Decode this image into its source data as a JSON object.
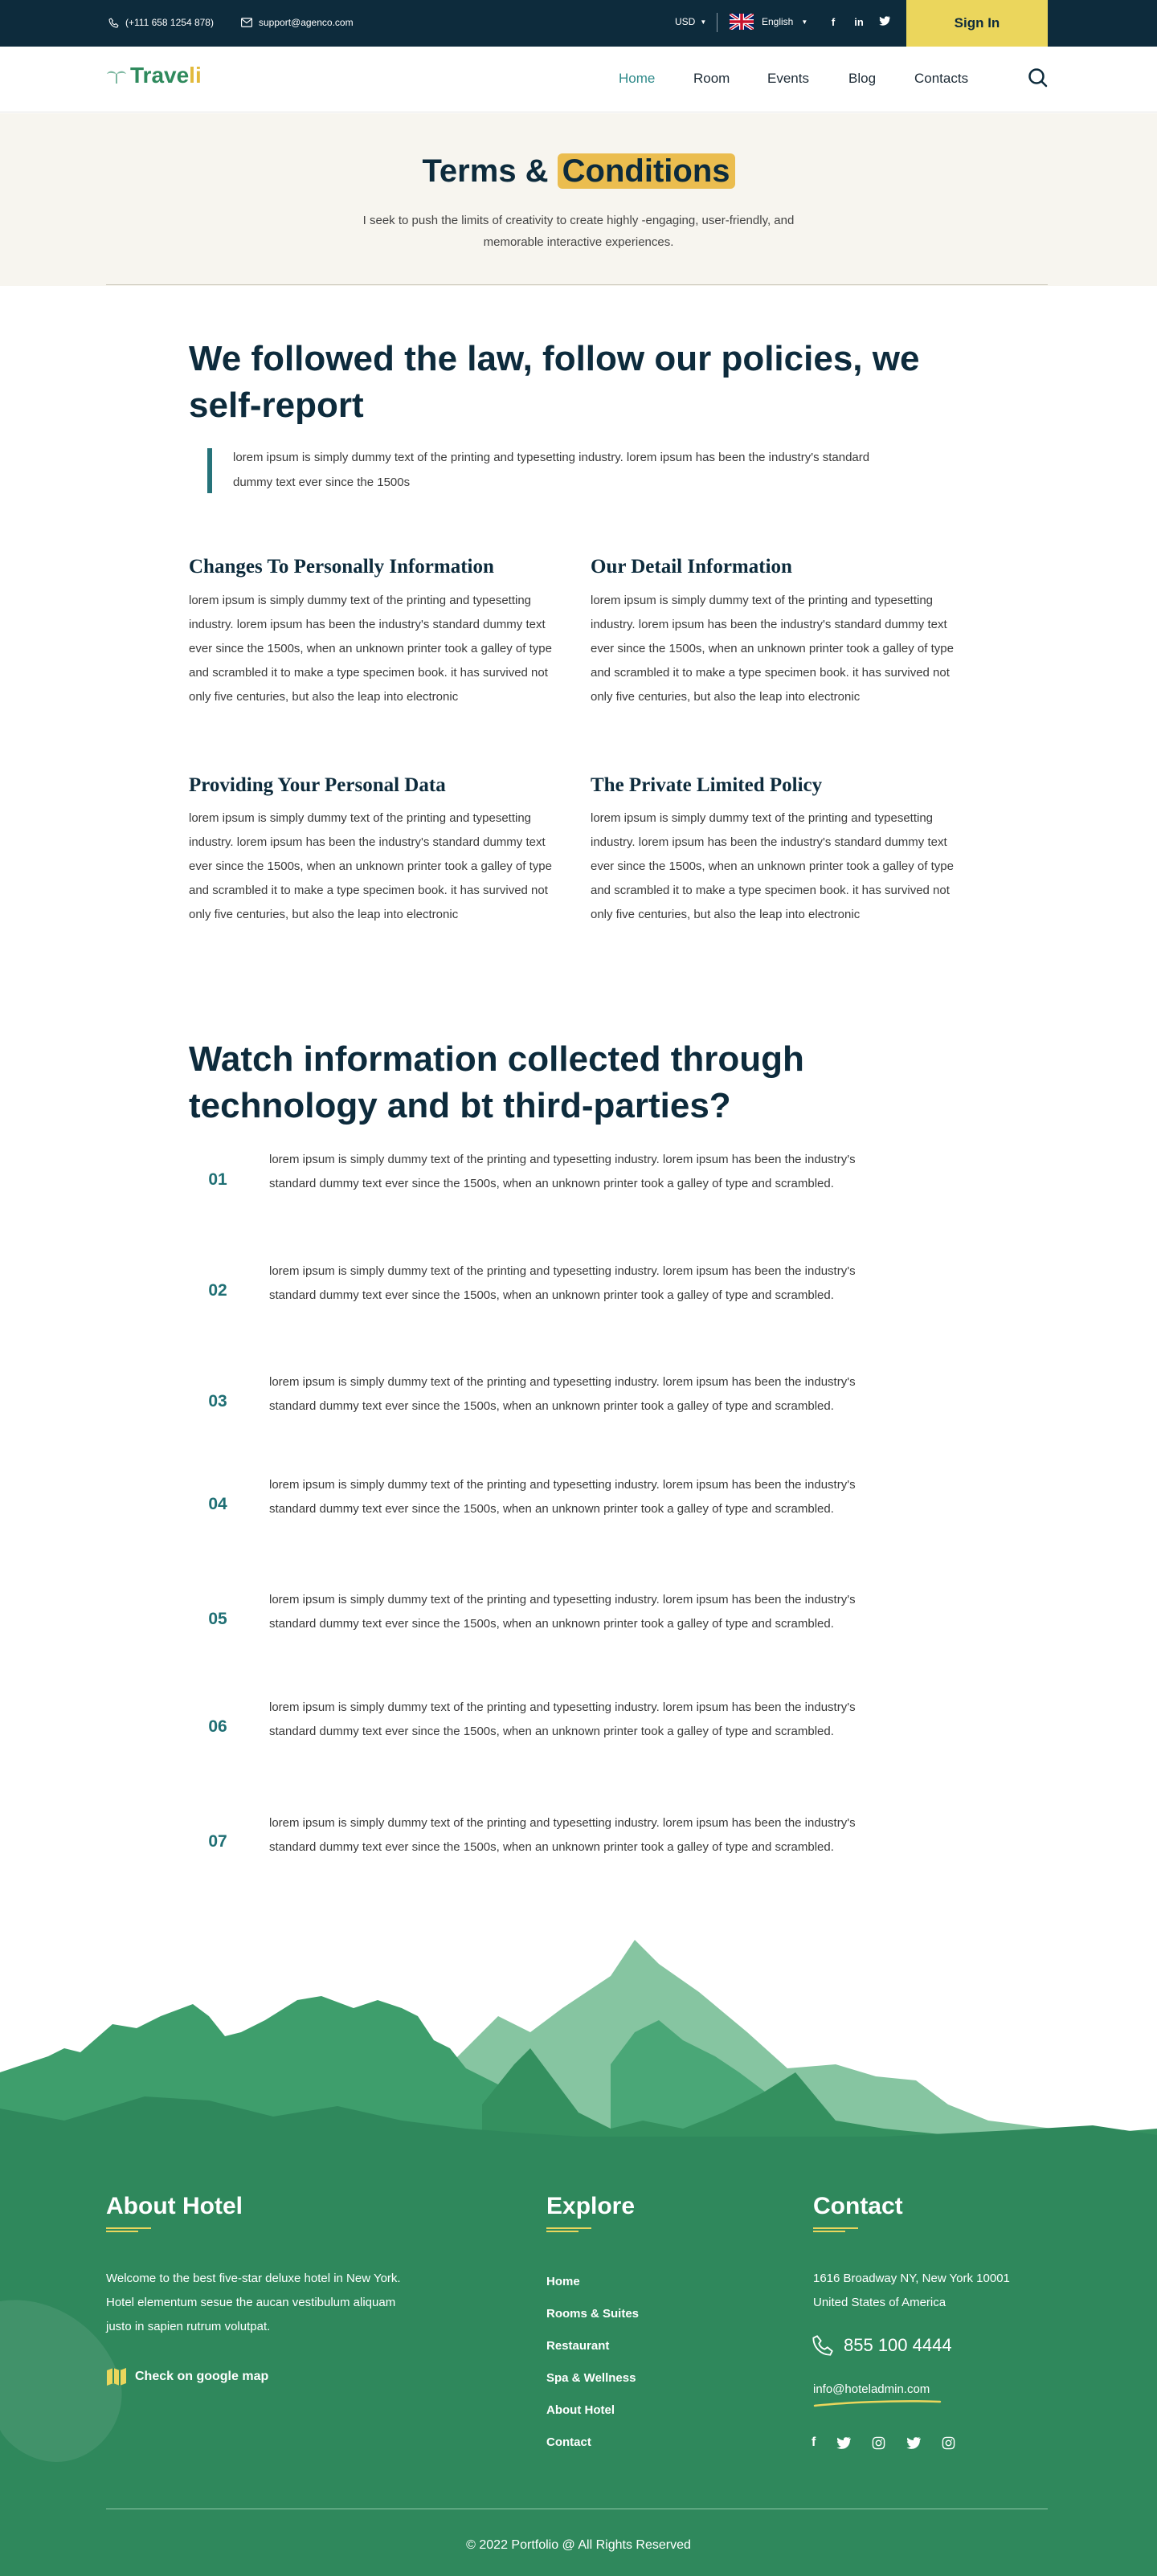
{
  "topbar": {
    "phone": "(+111 658 1254 878)",
    "email": "support@agenco.com",
    "currency": "USD",
    "language": "English",
    "signin_label": "Sign In",
    "social_icons": [
      "facebook-icon",
      "linkedin-icon",
      "twitter-icon"
    ]
  },
  "nav": {
    "logo_part1": "Trave",
    "logo_part2": "li",
    "items": [
      {
        "label": "Home",
        "active": true
      },
      {
        "label": "Room",
        "active": false
      },
      {
        "label": "Events",
        "active": false
      },
      {
        "label": "Blog",
        "active": false
      },
      {
        "label": "Contacts",
        "active": false
      }
    ]
  },
  "hero": {
    "title_part1": "Terms & ",
    "title_highlight": "Conditions",
    "subtitle": "I seek to push the limits of creativity to create highly -engaging, user-friendly, and memorable interactive experiences."
  },
  "intro": {
    "heading": "We followed the law, follow our policies, we self-report",
    "quote": "lorem ipsum is simply dummy text of the printing and typesetting industry. lorem ipsum has been the industry's standard dummy text ever since the 1500s"
  },
  "sections": [
    {
      "title": "Changes To Personally Information",
      "body": "lorem ipsum is simply dummy text of the printing and typesetting industry. lorem ipsum has been the industry's standard dummy text ever since the 1500s, when an unknown printer took a galley of type and scrambled it to make a type specimen book. it has survived not only five centuries, but also the leap into electronic"
    },
    {
      "title": "Our Detail Information",
      "body": "lorem ipsum is simply dummy text of the printing and typesetting industry. lorem ipsum has been the industry's standard dummy text ever since the 1500s, when an unknown printer took a galley of type and scrambled it to make a type specimen book. it has survived not only five centuries, but also the leap into electronic"
    },
    {
      "title": "Providing Your Personal Data",
      "body": "lorem ipsum is simply dummy text of the printing and typesetting industry. lorem ipsum has been the industry's standard dummy text ever since the 1500s, when an unknown printer took a galley of type and scrambled it to make a type specimen book. it has survived not only five centuries, but also the leap into electronic"
    },
    {
      "title": "The Private Limited Policy",
      "body": "lorem ipsum is simply dummy text of the printing and typesetting industry. lorem ipsum has been the industry's standard dummy text ever since the 1500s, when an unknown printer took a galley of type and scrambled it to make a type specimen book. it has survived not only five centuries, but also the leap into electronic"
    }
  ],
  "tech": {
    "heading": "Watch information collected through technology and bt third-parties?",
    "items": [
      {
        "num": "01",
        "text": "lorem ipsum is simply dummy text of the printing and typesetting industry. lorem ipsum has been the industry's standard dummy text ever since the 1500s, when an unknown printer took a galley of type and scrambled."
      },
      {
        "num": "02",
        "text": "lorem ipsum is simply dummy text of the printing and typesetting industry. lorem ipsum has been the industry's standard dummy text ever since the 1500s, when an unknown printer took a galley of type and scrambled."
      },
      {
        "num": "03",
        "text": "lorem ipsum is simply dummy text of the printing and typesetting industry. lorem ipsum has been the industry's standard dummy text ever since the 1500s, when an unknown printer took a galley of type and scrambled."
      },
      {
        "num": "04",
        "text": "lorem ipsum is simply dummy text of the printing and typesetting industry. lorem ipsum has been the industry's standard dummy text ever since the 1500s, when an unknown printer took a galley of type and scrambled."
      },
      {
        "num": "05",
        "text": "lorem ipsum is simply dummy text of the printing and typesetting industry. lorem ipsum has been the industry's standard dummy text ever since the 1500s, when an unknown printer took a galley of type and scrambled."
      },
      {
        "num": "06",
        "text": "lorem ipsum is simply dummy text of the printing and typesetting industry. lorem ipsum has been the industry's standard dummy text ever since the 1500s, when an unknown printer took a galley of type and scrambled."
      },
      {
        "num": "07",
        "text": "lorem ipsum is simply dummy text of the printing and typesetting industry. lorem ipsum has been the industry's standard dummy text ever since the 1500s, when an unknown printer took a galley of type and scrambled."
      }
    ]
  },
  "footer": {
    "about_title": "About Hotel",
    "about_text": "Welcome to the best five-star deluxe hotel in New York. Hotel elementum sesue the aucan vestibulum aliquam justo in sapien rutrum volutpat.",
    "map_link": "Check on google map",
    "explore_title": "Explore",
    "explore_links": [
      "Home",
      "Rooms & Suites",
      "Restaurant",
      "Spa & Wellness",
      "About Hotel",
      "Contact"
    ],
    "contact_title": "Contact",
    "address_line1": "1616 Broadway NY, New York 10001",
    "address_line2": "United States of America",
    "phone": "855 100 4444",
    "email": "info@hoteladmin.com",
    "social_icons": [
      "facebook-icon",
      "twitter-icon",
      "instagram-icon",
      "twitter-icon",
      "instagram-icon"
    ],
    "copyright": "© 2022 Portfolio @ All Rights Reserved"
  },
  "colors": {
    "dark": "#0d2b3c",
    "accent_yellow": "#ebd65c",
    "teal": "#2f8a8a",
    "footer_green": "#2f885c",
    "hero_bg": "#f7f5ef"
  }
}
